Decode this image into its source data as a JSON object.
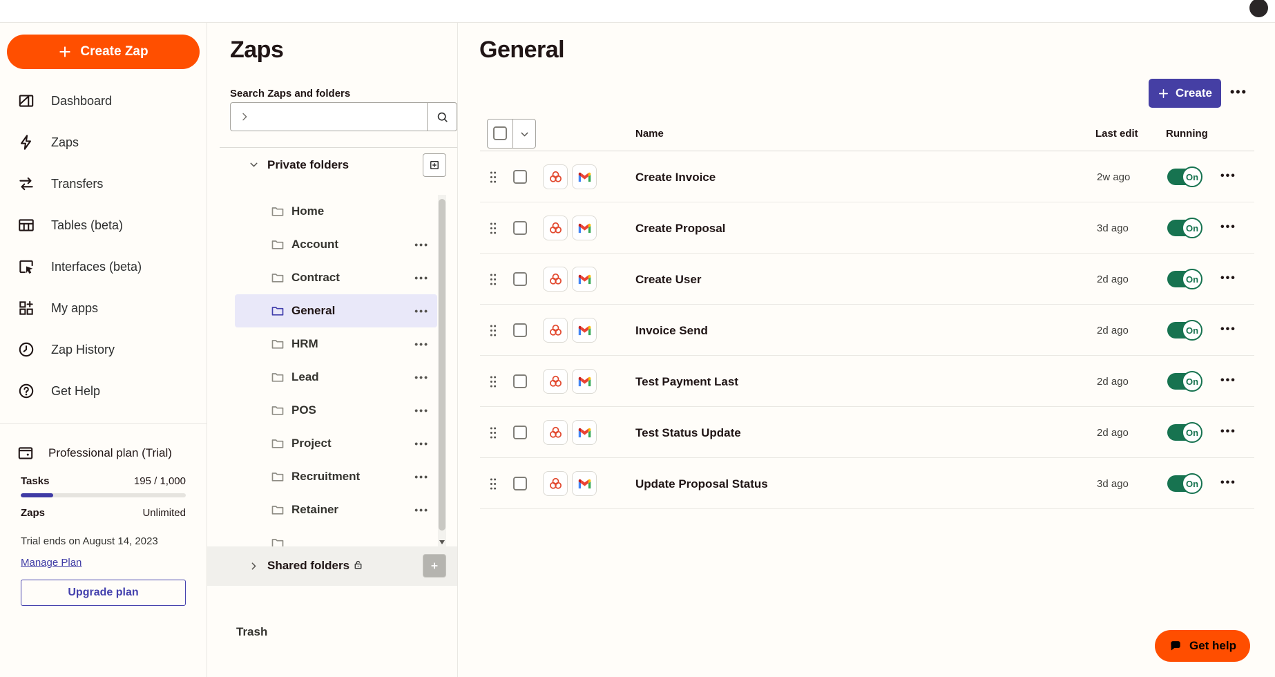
{
  "topbar": {
    "avatar_icon": "user-avatar"
  },
  "sidebar": {
    "create_zap": {
      "label": "Create Zap",
      "icon": "plus-icon"
    },
    "nav": [
      {
        "label": "Dashboard",
        "icon": "dashboard-icon"
      },
      {
        "label": "Zaps",
        "icon": "lightning-icon"
      },
      {
        "label": "Transfers",
        "icon": "transfer-arrows-icon"
      },
      {
        "label": "Tables (beta)",
        "icon": "table-icon"
      },
      {
        "label": "Interfaces (beta)",
        "icon": "interfaces-icon"
      },
      {
        "label": "My apps",
        "icon": "apps-grid-icon"
      },
      {
        "label": "Zap History",
        "icon": "clock-icon"
      },
      {
        "label": "Get Help",
        "icon": "question-circle-icon"
      }
    ],
    "plan": {
      "icon": "wallet-icon",
      "name": "Professional plan (Trial)",
      "tasks_label": "Tasks",
      "tasks_value": "195 / 1,000",
      "tasks_progress_percent": 19.5,
      "zaps_label": "Zaps",
      "zaps_value": "Unlimited",
      "trial_note": "Trial ends on August 14, 2023",
      "manage_plan_link": "Manage Plan",
      "upgrade_button": "Upgrade plan"
    }
  },
  "folders_panel": {
    "title": "Zaps",
    "search": {
      "label": "Search Zaps and folders",
      "value": "",
      "icon": "magnifier-icon",
      "chevron_icon": "chevron-right-icon"
    },
    "private_folders": {
      "header": "Private folders",
      "add_button_icon": "add-folder-icon",
      "items": [
        {
          "name": "Home",
          "selected": false,
          "has_menu": false
        },
        {
          "name": "Account",
          "selected": false,
          "has_menu": true
        },
        {
          "name": "Contract",
          "selected": false,
          "has_menu": true
        },
        {
          "name": "General",
          "selected": true,
          "has_menu": true
        },
        {
          "name": "HRM",
          "selected": false,
          "has_menu": true
        },
        {
          "name": "Lead",
          "selected": false,
          "has_menu": true
        },
        {
          "name": "POS",
          "selected": false,
          "has_menu": true
        },
        {
          "name": "Project",
          "selected": false,
          "has_menu": true
        },
        {
          "name": "Recruitment",
          "selected": false,
          "has_menu": true
        },
        {
          "name": "Retainer",
          "selected": false,
          "has_menu": true
        }
      ]
    },
    "shared_folders": {
      "header": "Shared folders",
      "lock_icon": "lock-icon",
      "add_button_icon": "add-folder-icon"
    },
    "trash_label": "Trash"
  },
  "main": {
    "title": "General",
    "create_button": {
      "label": "Create",
      "icon": "plus-icon"
    },
    "more_menu_icon": "ellipsis-icon",
    "table": {
      "columns": {
        "name": "Name",
        "last_edit": "Last edit",
        "running": "Running"
      },
      "toggle_on_label": "On",
      "app_icons": [
        "zoho-icon",
        "gmail-icon"
      ],
      "rows": [
        {
          "name": "Create Invoice",
          "last_edit": "2w ago",
          "running": true
        },
        {
          "name": "Create Proposal",
          "last_edit": "3d ago",
          "running": true
        },
        {
          "name": "Create User",
          "last_edit": "2d ago",
          "running": true
        },
        {
          "name": "Invoice Send",
          "last_edit": "2d ago",
          "running": true
        },
        {
          "name": "Test Payment Last",
          "last_edit": "2d ago",
          "running": true
        },
        {
          "name": "Test Status Update",
          "last_edit": "2d ago",
          "running": true
        },
        {
          "name": "Update Proposal Status",
          "last_edit": "3d ago",
          "running": true
        }
      ]
    }
  },
  "help_button": {
    "label": "Get help",
    "icon": "chat-bubble-icon"
  },
  "colors": {
    "brand_orange": "#ff4f00",
    "accent_indigo": "#453fa4",
    "toggle_green": "#177350",
    "selected_folder_bg": "#e9e8f9",
    "background": "#fffdf9"
  }
}
